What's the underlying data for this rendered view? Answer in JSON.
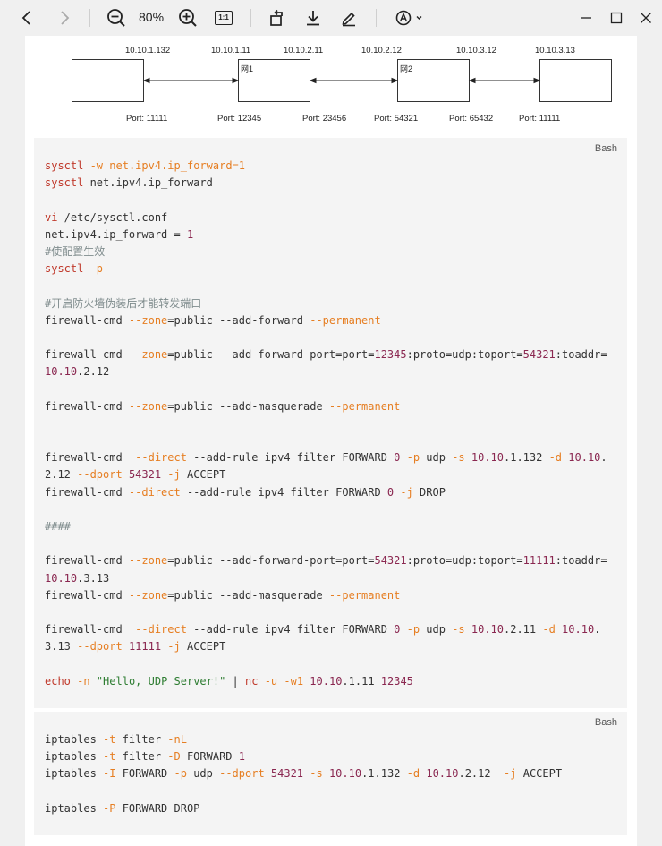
{
  "toolbar": {
    "zoom_level": "80%",
    "actual_size_label": "1:1"
  },
  "diagram": {
    "ip_labels": [
      "10.10.1.132",
      "10.10.1.11",
      "10.10.2.11",
      "10.10.2.12",
      "10.10.3.12",
      "10.10.3.13"
    ],
    "port_labels": [
      "Port: 11111",
      "Port: 12345",
      "Port: 23456",
      "Port: 54321",
      "Port: 65432",
      "Port: 11111"
    ],
    "box_labels": [
      "",
      "网1",
      "",
      "网2"
    ]
  },
  "code_block_1": {
    "language": "Bash",
    "lines": [
      [
        [
          "k",
          "sysctl"
        ],
        [
          "",
          ""
        ],
        [
          "o",
          " -w"
        ],
        [
          "o",
          " net.ipv4.ip_forward=1"
        ]
      ],
      [
        [
          "k",
          "sysctl"
        ],
        [
          "",
          " net.ipv4.ip_forward"
        ]
      ],
      [],
      [
        [
          "k",
          "vi"
        ],
        [
          "",
          " /etc/sysctl.conf"
        ]
      ],
      [
        [
          "",
          "net.ipv4.ip_forward = "
        ],
        [
          "n",
          "1"
        ]
      ],
      [
        [
          "c",
          "#使配置生效"
        ]
      ],
      [
        [
          "k",
          "sysctl"
        ],
        [
          "o",
          " -p"
        ]
      ],
      [],
      [
        [
          "c",
          "#开启防火墙伪装后才能转发端口"
        ]
      ],
      [
        [
          "",
          "firewall-cmd "
        ],
        [
          "o",
          "--zone"
        ],
        [
          "",
          "=public --add-forward "
        ],
        [
          "o",
          "--permanent"
        ]
      ],
      [],
      [
        [
          "",
          "firewall-cmd "
        ],
        [
          "o",
          "--zone"
        ],
        [
          "",
          "=public --add-forward-port=port="
        ],
        [
          "n",
          "12345"
        ],
        [
          "",
          ":proto=udp:toport="
        ],
        [
          "n",
          "54321"
        ],
        [
          "",
          ":toaddr="
        ]
      ],
      [
        [
          "n",
          "10.10"
        ],
        [
          "",
          ".2.12"
        ]
      ],
      [],
      [
        [
          "",
          "firewall-cmd "
        ],
        [
          "o",
          "--zone"
        ],
        [
          "",
          "=public --add-masquerade "
        ],
        [
          "o",
          "--permanent"
        ]
      ],
      [],
      [],
      [
        [
          "",
          "firewall-cmd  "
        ],
        [
          "o",
          "--direct"
        ],
        [
          "",
          " --add-rule ipv4 filter FORWARD "
        ],
        [
          "n",
          "0"
        ],
        [
          "o",
          " -p"
        ],
        [
          "",
          " udp "
        ],
        [
          "o",
          "-s"
        ],
        [
          "",
          " "
        ],
        [
          "n",
          "10.10"
        ],
        [
          "",
          ".1.132 "
        ],
        [
          "o",
          "-d"
        ],
        [
          "",
          " "
        ],
        [
          "n",
          "10.10"
        ],
        [
          "",
          "."
        ]
      ],
      [
        [
          "",
          "2.12 "
        ],
        [
          "o",
          "--dport"
        ],
        [
          "",
          " "
        ],
        [
          "n",
          "54321"
        ],
        [
          "o",
          " -j"
        ],
        [
          "",
          " ACCEPT"
        ]
      ],
      [
        [
          "",
          "firewall-cmd "
        ],
        [
          "o",
          "--direct"
        ],
        [
          "",
          " --add-rule ipv4 filter FORWARD "
        ],
        [
          "n",
          "0"
        ],
        [
          "o",
          " -j"
        ],
        [
          "",
          " DROP"
        ]
      ],
      [],
      [
        [
          "c",
          "####"
        ]
      ],
      [],
      [
        [
          "",
          "firewall-cmd "
        ],
        [
          "o",
          "--zone"
        ],
        [
          "",
          "=public --add-forward-port=port="
        ],
        [
          "n",
          "54321"
        ],
        [
          "",
          ":proto=udp:toport="
        ],
        [
          "n",
          "11111"
        ],
        [
          "",
          ":toaddr="
        ]
      ],
      [
        [
          "n",
          "10.10"
        ],
        [
          "",
          ".3.13"
        ]
      ],
      [
        [
          "",
          "firewall-cmd "
        ],
        [
          "o",
          "--zone"
        ],
        [
          "",
          "=public --add-masquerade "
        ],
        [
          "o",
          "--permanent"
        ]
      ],
      [],
      [
        [
          "",
          "firewall-cmd  "
        ],
        [
          "o",
          "--direct"
        ],
        [
          "",
          " --add-rule ipv4 filter FORWARD "
        ],
        [
          "n",
          "0"
        ],
        [
          "o",
          " -p"
        ],
        [
          "",
          " udp "
        ],
        [
          "o",
          "-s"
        ],
        [
          "",
          " "
        ],
        [
          "n",
          "10.10"
        ],
        [
          "",
          ".2.11 "
        ],
        [
          "o",
          "-d"
        ],
        [
          "",
          " "
        ],
        [
          "n",
          "10.10"
        ],
        [
          "",
          "."
        ]
      ],
      [
        [
          "",
          "3.13 "
        ],
        [
          "o",
          "--dport"
        ],
        [
          "",
          " "
        ],
        [
          "n",
          "11111"
        ],
        [
          "o",
          " -j"
        ],
        [
          "",
          " ACCEPT"
        ]
      ],
      [],
      [
        [
          "k",
          "echo"
        ],
        [
          "o",
          " -n"
        ],
        [
          "",
          " "
        ],
        [
          "s",
          "\"Hello, UDP Server!\""
        ],
        [
          "",
          " | "
        ],
        [
          "k",
          "nc"
        ],
        [
          "o",
          " -u"
        ],
        [
          "o",
          " -w1"
        ],
        [
          "",
          " "
        ],
        [
          "n",
          "10.10"
        ],
        [
          "",
          ".1.11 "
        ],
        [
          "n",
          "12345"
        ]
      ]
    ]
  },
  "code_block_2": {
    "language": "Bash",
    "lines": [
      [
        [
          "",
          "iptables "
        ],
        [
          "o",
          "-t"
        ],
        [
          "",
          " filter "
        ],
        [
          "o",
          "-nL"
        ]
      ],
      [
        [
          "",
          "iptables "
        ],
        [
          "o",
          "-t"
        ],
        [
          "",
          " filter "
        ],
        [
          "o",
          "-D"
        ],
        [
          "",
          " FORWARD "
        ],
        [
          "n",
          "1"
        ]
      ],
      [
        [
          "",
          "iptables "
        ],
        [
          "o",
          "-I"
        ],
        [
          "",
          " FORWARD "
        ],
        [
          "o",
          "-p"
        ],
        [
          "",
          " udp "
        ],
        [
          "o",
          "--dport"
        ],
        [
          "",
          " "
        ],
        [
          "n",
          "54321"
        ],
        [
          "o",
          " -s"
        ],
        [
          "",
          " "
        ],
        [
          "n",
          "10.10"
        ],
        [
          "",
          ".1.132 "
        ],
        [
          "o",
          "-d"
        ],
        [
          "",
          " "
        ],
        [
          "n",
          "10.10"
        ],
        [
          "",
          ".2.12  "
        ],
        [
          "o",
          "-j"
        ],
        [
          "",
          " ACCEPT"
        ]
      ],
      [],
      [
        [
          "",
          "iptables "
        ],
        [
          "o",
          "-P"
        ],
        [
          "",
          " FORWARD DROP"
        ]
      ]
    ]
  }
}
